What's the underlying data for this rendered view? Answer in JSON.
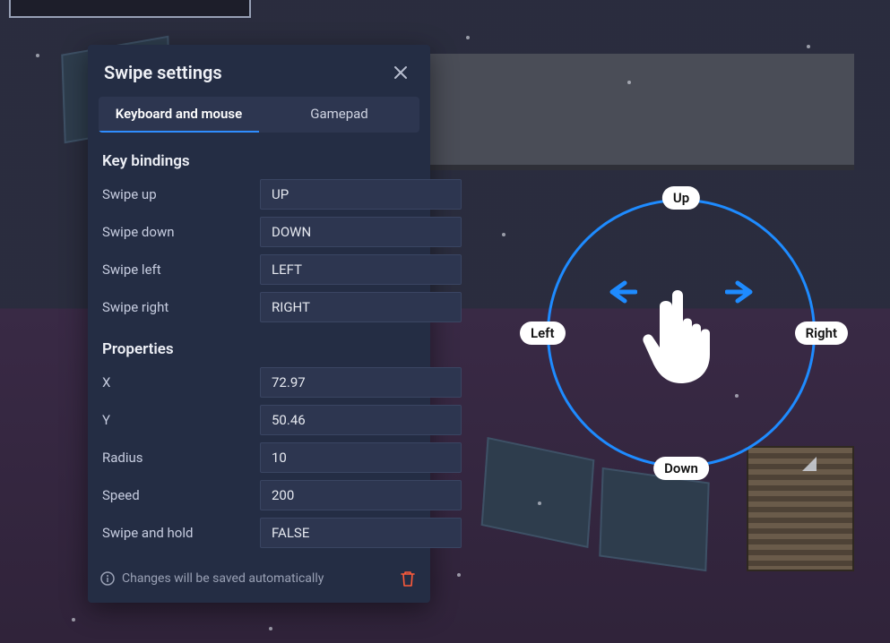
{
  "panel": {
    "title": "Swipe settings",
    "footer_text": "Changes will be saved automatically"
  },
  "tabs": [
    {
      "label": "Keyboard and mouse",
      "active": true
    },
    {
      "label": "Gamepad",
      "active": false
    }
  ],
  "key_bindings": {
    "section_title": "Key bindings",
    "rows": [
      {
        "label": "Swipe up",
        "value": "UP"
      },
      {
        "label": "Swipe down",
        "value": "DOWN"
      },
      {
        "label": "Swipe left",
        "value": "LEFT"
      },
      {
        "label": "Swipe right",
        "value": "RIGHT"
      }
    ]
  },
  "properties": {
    "section_title": "Properties",
    "rows": [
      {
        "label": "X",
        "value": "72.97"
      },
      {
        "label": "Y",
        "value": "50.46"
      },
      {
        "label": "Radius",
        "value": "10"
      },
      {
        "label": "Speed",
        "value": "200"
      },
      {
        "label": "Swipe and hold",
        "value": "FALSE"
      }
    ]
  },
  "overlay": {
    "labels": {
      "up": "Up",
      "down": "Down",
      "left": "Left",
      "right": "Right"
    }
  },
  "colors": {
    "accent": "#2f8dff",
    "panel_bg": "#242d44",
    "input_bg": "#2d3650",
    "danger": "#ff5b3a"
  }
}
